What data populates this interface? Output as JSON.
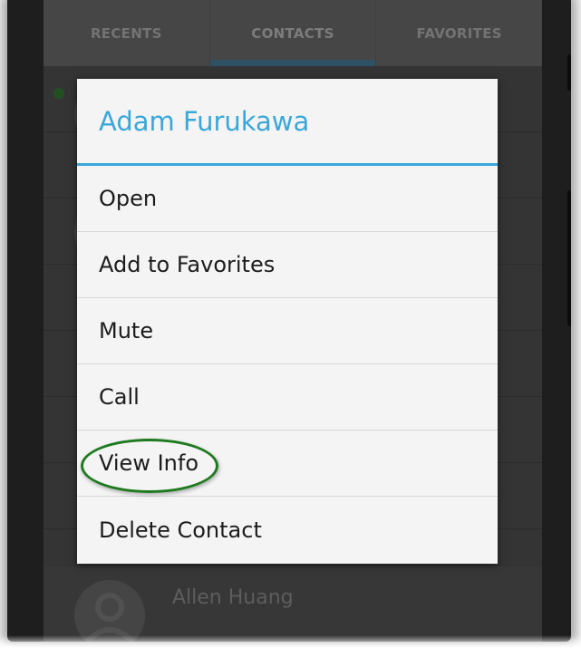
{
  "tabs": [
    {
      "label": "RECENTS"
    },
    {
      "label": "CONTACTS"
    },
    {
      "label": "FAVORITES"
    }
  ],
  "background_contact": {
    "name": "Allen Huang"
  },
  "dialog": {
    "title": "Adam Furukawa",
    "items": [
      {
        "label": "Open"
      },
      {
        "label": "Add to Favorites"
      },
      {
        "label": "Mute"
      },
      {
        "label": "Call"
      },
      {
        "label": "View Info"
      },
      {
        "label": "Delete Contact"
      }
    ],
    "highlighted_item": "View Info"
  },
  "colors": {
    "accent": "#3aa7d8",
    "highlight_ring": "#1e7a1e",
    "active_tab_indicator": "#3e6d86",
    "presence": "#2f6b2f"
  }
}
